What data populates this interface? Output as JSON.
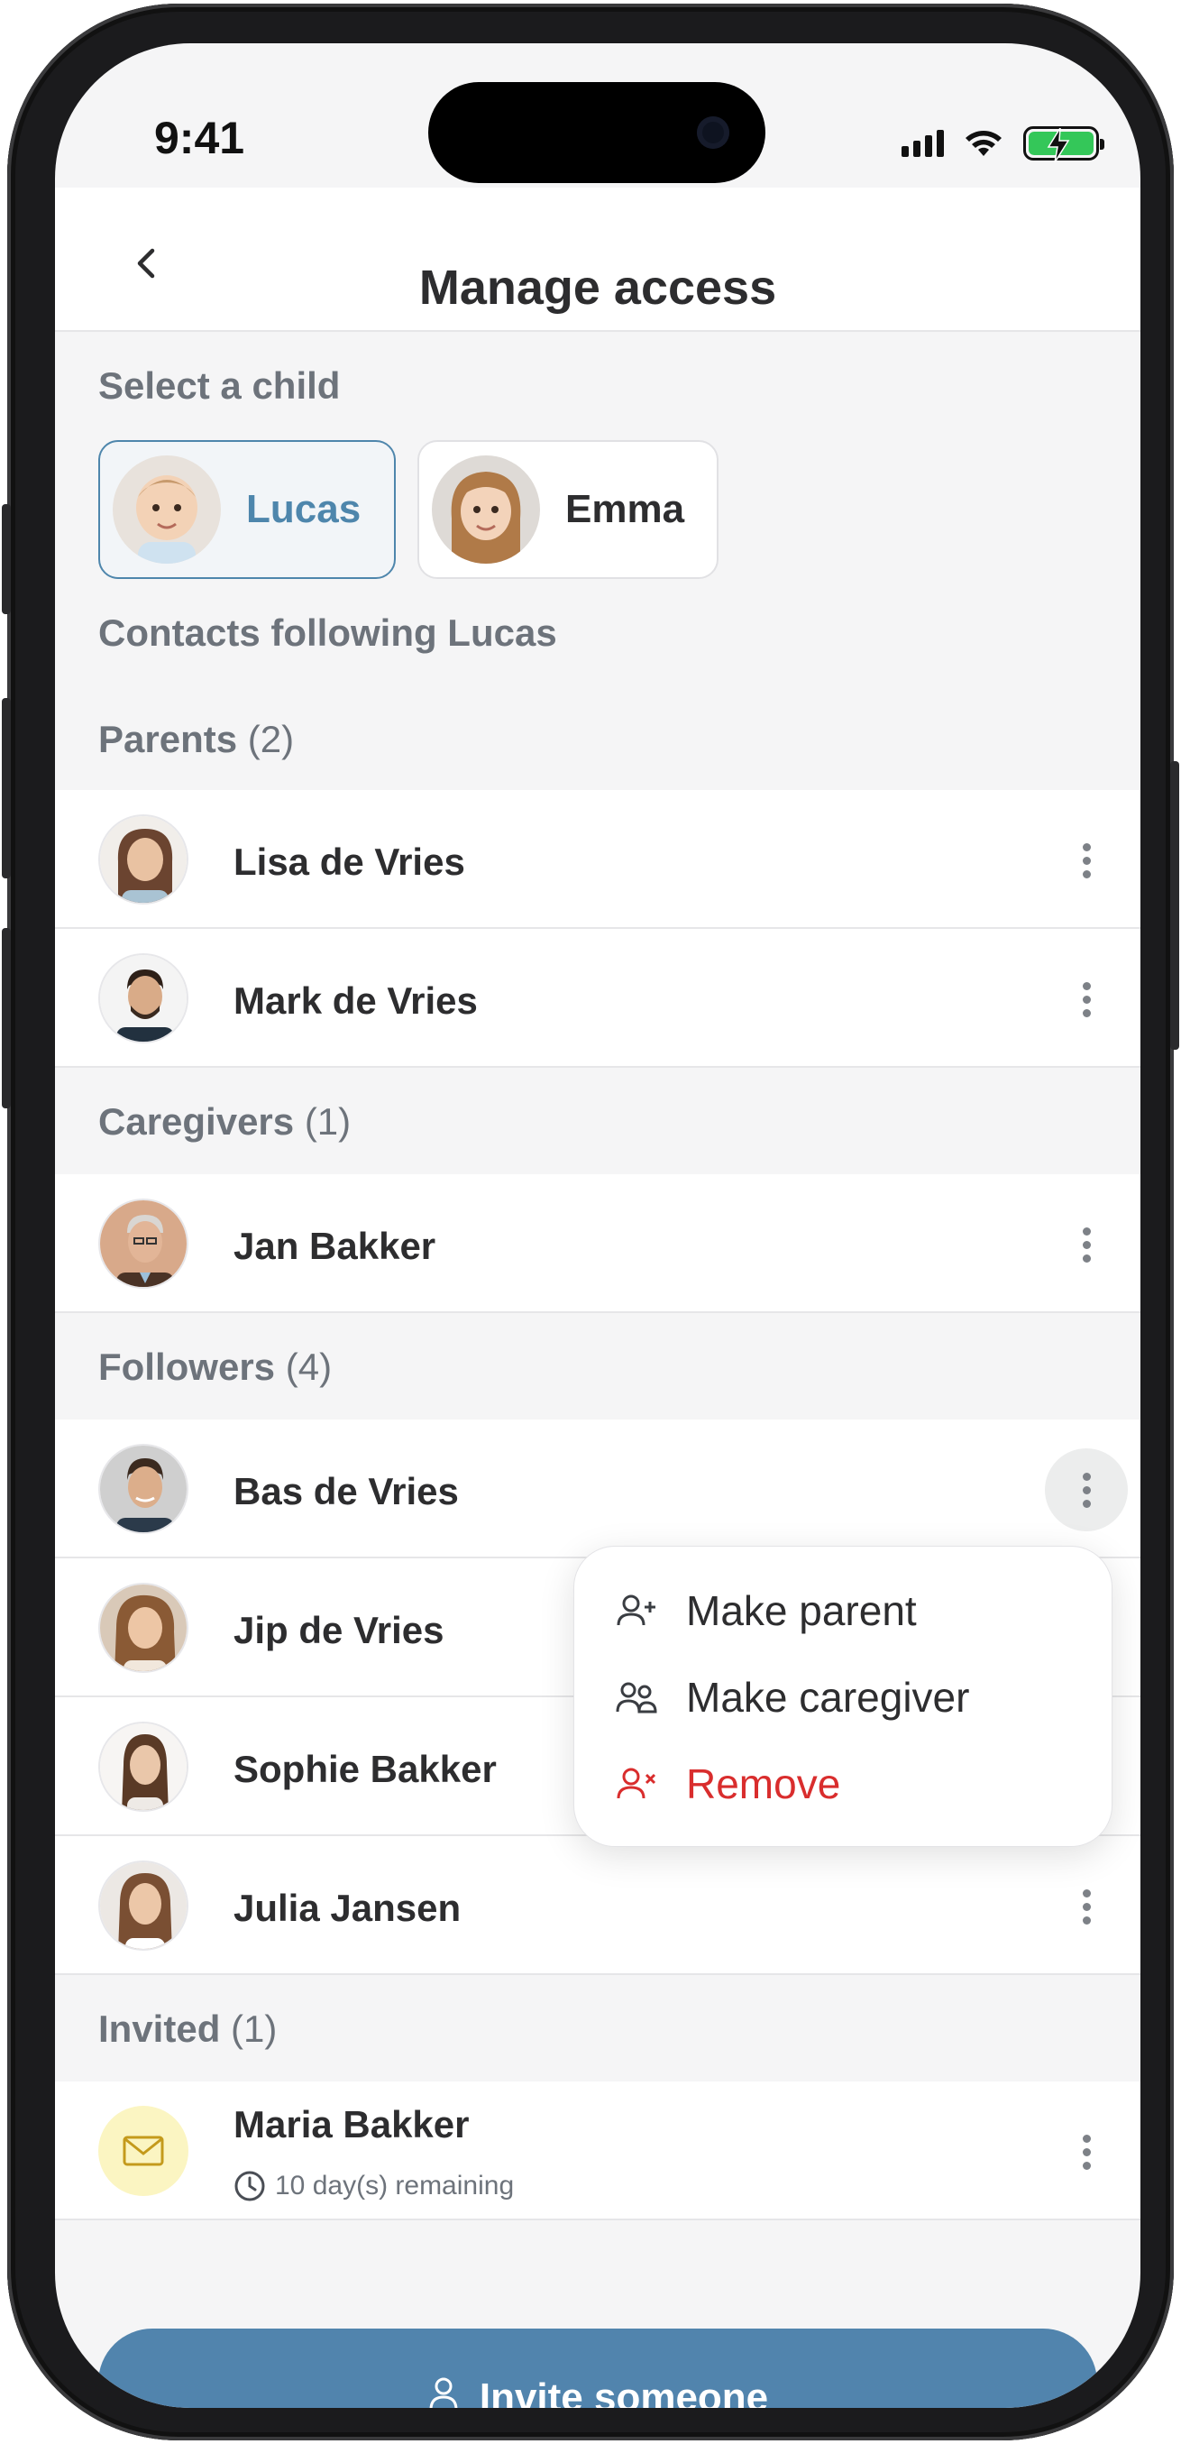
{
  "status_bar": {
    "time": "9:41"
  },
  "header": {
    "title": "Manage access"
  },
  "select_child": {
    "label": "Select a child",
    "children": [
      {
        "name": "Lucas",
        "selected": true
      },
      {
        "name": "Emma",
        "selected": false
      }
    ]
  },
  "contacts_label": "Contacts following Lucas",
  "groups": {
    "parents": {
      "title": "Parents",
      "count": "(2)",
      "members": [
        "Lisa de Vries",
        "Mark de Vries"
      ]
    },
    "caregivers": {
      "title": "Caregivers",
      "count": "(1)",
      "members": [
        "Jan Bakker"
      ]
    },
    "followers": {
      "title": "Followers",
      "count": "(4)",
      "members": [
        "Bas de Vries",
        "Jip de Vries",
        "Sophie Bakker",
        "Julia Jansen"
      ]
    },
    "invited": {
      "title": "Invited",
      "count": "(1)",
      "members": [
        {
          "name": "Maria Bakker",
          "remaining": "10 day(s) remaining"
        }
      ]
    }
  },
  "context_menu": {
    "items": [
      {
        "label": "Make parent",
        "icon": "user-plus-icon"
      },
      {
        "label": "Make caregiver",
        "icon": "users-icon"
      },
      {
        "label": "Remove",
        "icon": "user-remove-icon",
        "color": "#d92d2d"
      }
    ]
  },
  "footer": {
    "invite_label": "Invite someone"
  },
  "colors": {
    "accent": "#4e86ac",
    "button": "#5184ad",
    "danger": "#d92d2d"
  }
}
